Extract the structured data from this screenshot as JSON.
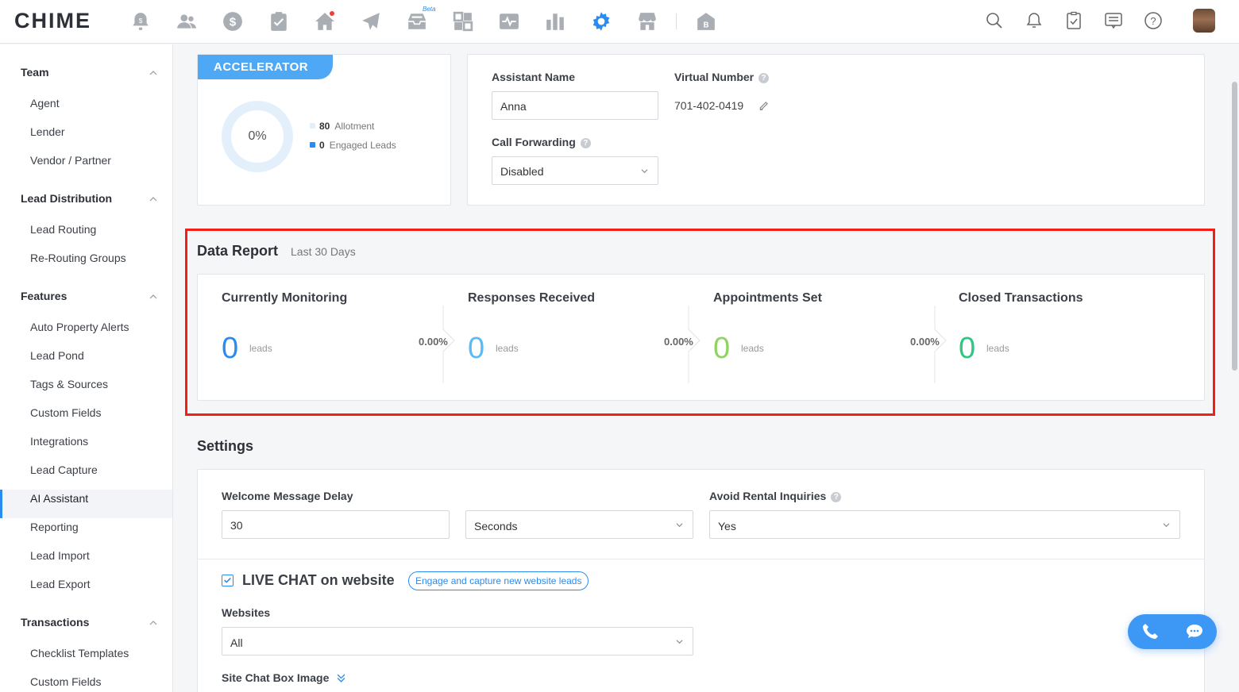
{
  "app": {
    "logo": "CHIME",
    "beta_label": "Beta"
  },
  "topnav": {
    "icons": [
      "bell-dollar-icon",
      "people-icon",
      "dollar-icon",
      "clipboard-check-icon",
      "home-icon",
      "send-icon",
      "inbox-icon",
      "widgets-icon",
      "pulse-icon",
      "bar-chart-icon",
      "gear-icon",
      "storefront-icon",
      "building-b-icon"
    ],
    "right_icons": [
      "search-icon",
      "bell-icon",
      "clipboard-icon",
      "message-icon",
      "help-icon"
    ],
    "active_icon": "gear-icon",
    "accent": "#2a8cf0"
  },
  "sidebar": {
    "sections": [
      {
        "title": "Team",
        "items": [
          "Agent",
          "Lender",
          "Vendor / Partner"
        ]
      },
      {
        "title": "Lead Distribution",
        "items": [
          "Lead Routing",
          "Re-Routing Groups"
        ]
      },
      {
        "title": "Features",
        "items": [
          "Auto Property Alerts",
          "Lead Pond",
          "Tags & Sources",
          "Custom Fields",
          "Integrations",
          "Lead Capture",
          "AI Assistant",
          "Reporting",
          "Lead Import",
          "Lead Export"
        ]
      },
      {
        "title": "Transactions",
        "items": [
          "Checklist Templates",
          "Custom Fields"
        ]
      }
    ],
    "active_item": "AI Assistant"
  },
  "accelerator": {
    "tag": "ACCELERATOR",
    "percent": "0%",
    "allotment_value": "80",
    "allotment_label": "Allotment",
    "engaged_value": "0",
    "engaged_label": "Engaged Leads"
  },
  "assistant": {
    "name_label": "Assistant Name",
    "name_value": "Anna",
    "virtual_label": "Virtual Number",
    "virtual_value": "701-402-0419",
    "forward_label": "Call Forwarding",
    "forward_value": "Disabled"
  },
  "data_report": {
    "title": "Data Report",
    "subtitle": "Last 30 Days",
    "metrics": [
      {
        "title": "Currently Monitoring",
        "value": "0",
        "unit": "leads",
        "color": "#2a8cf0"
      },
      {
        "title": "Responses Received",
        "value": "0",
        "unit": "leads",
        "color": "#5bbcf5"
      },
      {
        "title": "Appointments Set",
        "value": "0",
        "unit": "leads",
        "color": "#8fd460"
      },
      {
        "title": "Closed Transactions",
        "value": "0",
        "unit": "leads",
        "color": "#2fc783"
      }
    ],
    "rates": [
      "0.00%",
      "0.00%",
      "0.00%"
    ]
  },
  "settings": {
    "title": "Settings",
    "delay_label": "Welcome Message Delay",
    "delay_value": "30",
    "delay_unit": "Seconds",
    "rental_label": "Avoid Rental Inquiries",
    "rental_value": "Yes",
    "live_chat_label": "LIVE CHAT on website",
    "live_chat_pill": "Engage and capture new website leads",
    "live_chat_checked": true,
    "websites_label": "Websites",
    "websites_value": "All",
    "chatbox_label": "Site Chat Box Image"
  }
}
